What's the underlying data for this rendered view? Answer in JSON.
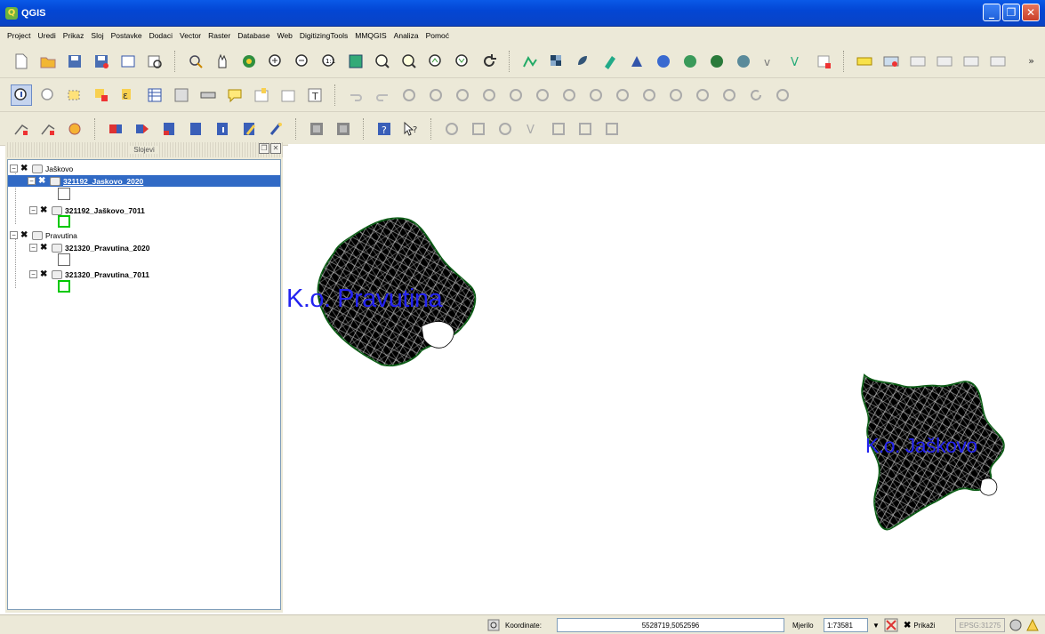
{
  "window": {
    "title": "QGIS",
    "app_icon": "qgis-logo-icon"
  },
  "menu": [
    "Project",
    "Uredi",
    "Prikaz",
    "Sloj",
    "Postavke",
    "Dodaci",
    "Vector",
    "Raster",
    "Database",
    "Web",
    "DigitizingTools",
    "MMQGIS",
    "Analiza",
    "Pomoć"
  ],
  "layers_panel": {
    "title": "Slojevi",
    "groups": [
      {
        "name": "Jaškovo",
        "layers": [
          "321192_Jaskovo_2020",
          "321192_Jaškovo_7011"
        ]
      },
      {
        "name": "Pravutina",
        "layers": [
          "321320_Pravutina_2020",
          "321320_Pravutina_7011"
        ]
      }
    ],
    "selected_layer": "321192_Jaskovo_2020"
  },
  "map": {
    "labels": [
      "K.o. Pravutina",
      "K.o. Jaškovo"
    ],
    "label_color": "#2323f0",
    "outline_color": "#0a5a14"
  },
  "statusbar": {
    "coord_label": "Koordinate:",
    "coord_value": "5528719,5052596",
    "scale_label": "Mjerilo",
    "scale_value": "1:73581",
    "render_label": "Prikaži",
    "crs": "EPSG:31275"
  }
}
